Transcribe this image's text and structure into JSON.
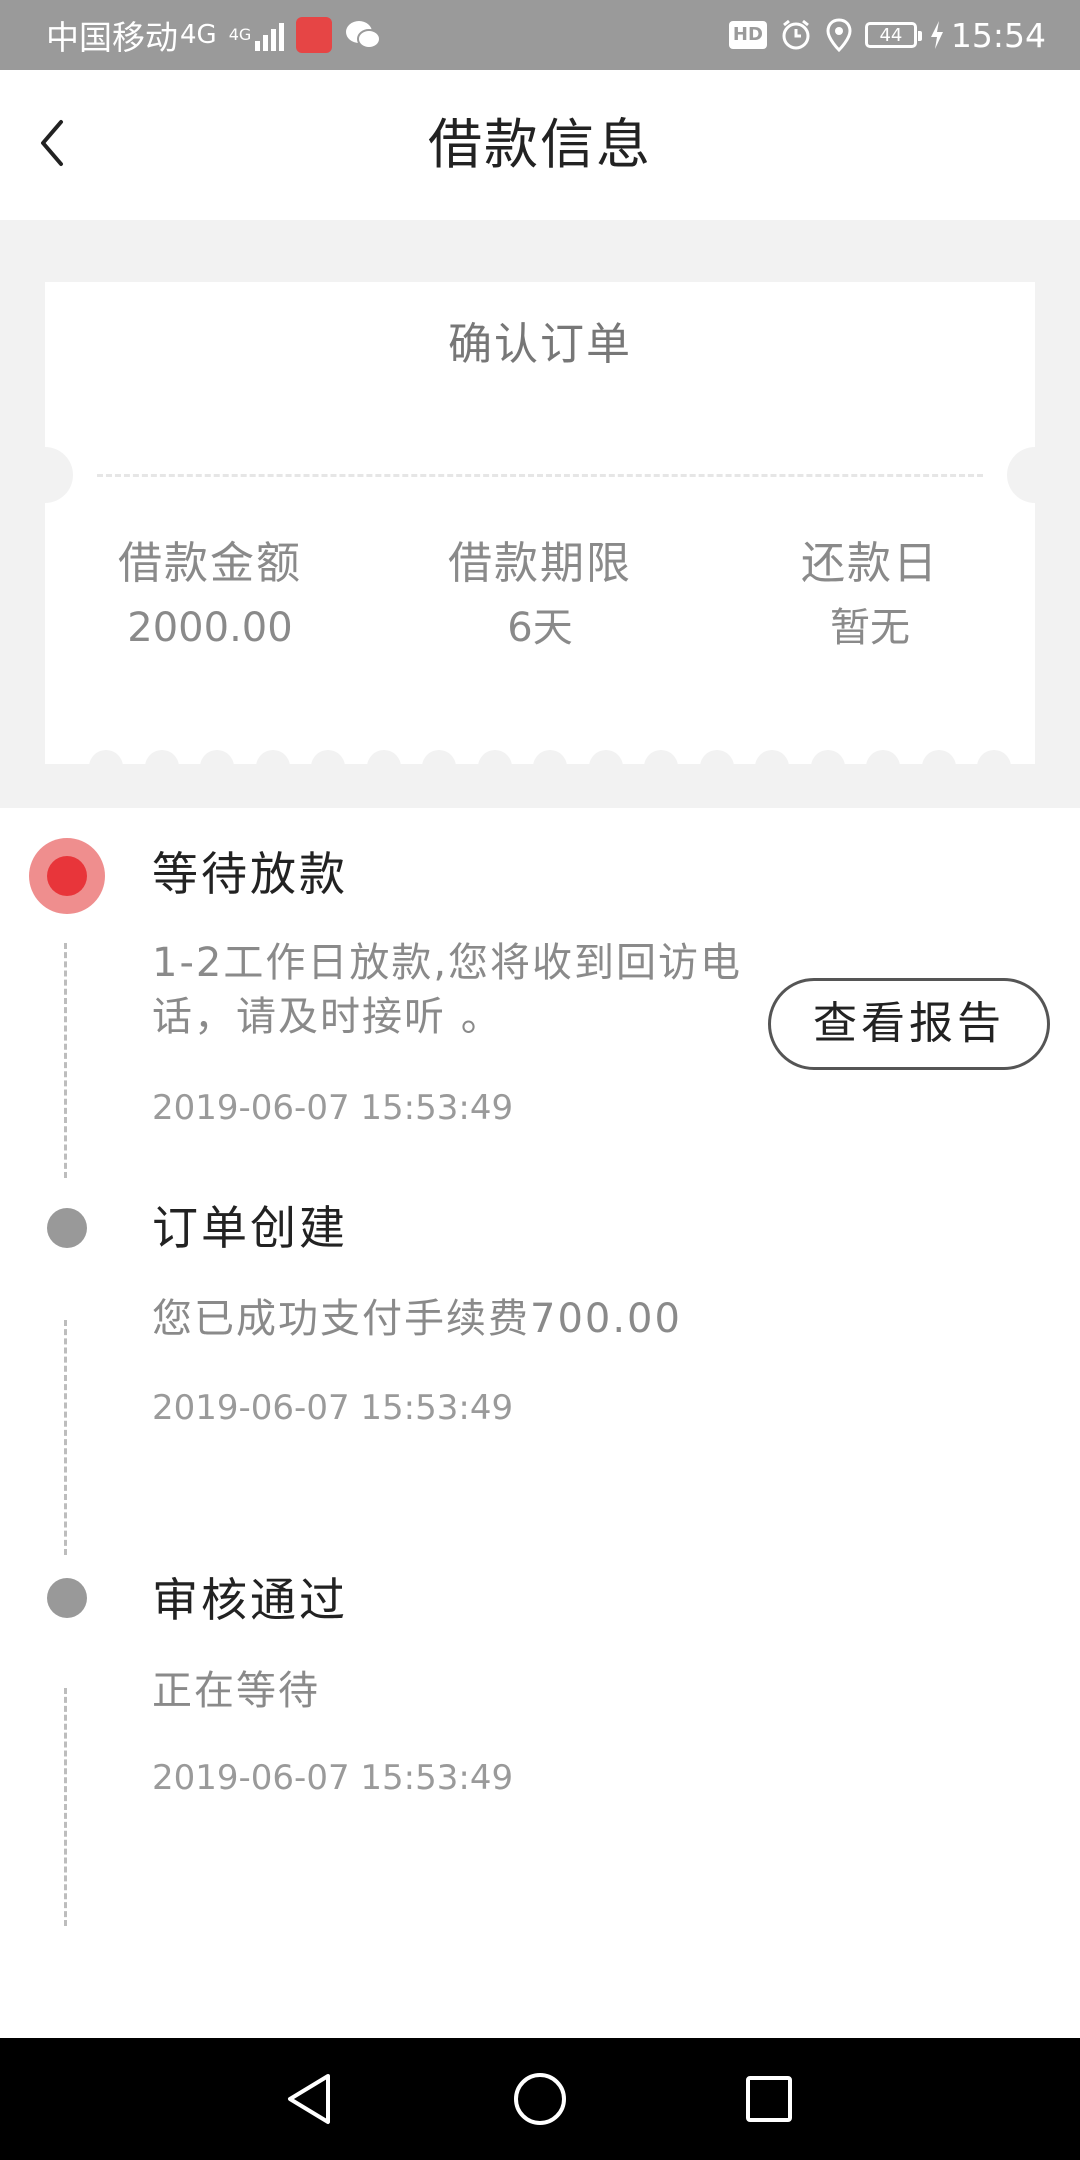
{
  "status_bar": {
    "carrier": "中国移动",
    "network": "4G",
    "network_small": "4G",
    "hd": "HD",
    "battery": "44",
    "time": "15:54"
  },
  "header": {
    "back_icon": "chevron-left-icon",
    "title": "借款信息"
  },
  "ticket": {
    "title": "确认订单",
    "columns": [
      {
        "label": "借款金额",
        "value": "2000.00"
      },
      {
        "label": "借款期限",
        "value": "6天"
      },
      {
        "label": "还款日",
        "value": "暂无"
      }
    ]
  },
  "timeline": {
    "items": [
      {
        "title": "等待放款",
        "desc": "1-2工作日放款,您将收到回访电话，请及时接听 。",
        "time": "2019-06-07 15:53:49",
        "active": true
      },
      {
        "title": "订单创建",
        "desc": "您已成功支付手续费700.00",
        "time": "2019-06-07 15:53:49",
        "active": false
      },
      {
        "title": "审核通过",
        "desc": "正在等待",
        "time": "2019-06-07 15:53:49",
        "active": false
      }
    ],
    "report_button": "查看报告"
  },
  "colors": {
    "active_dot": "#e8353a",
    "active_halo": "#ef8e8e",
    "inactive_dot": "#999999",
    "page_bg": "#f2f2f2",
    "status_bar_bg": "#9a9a9a"
  }
}
